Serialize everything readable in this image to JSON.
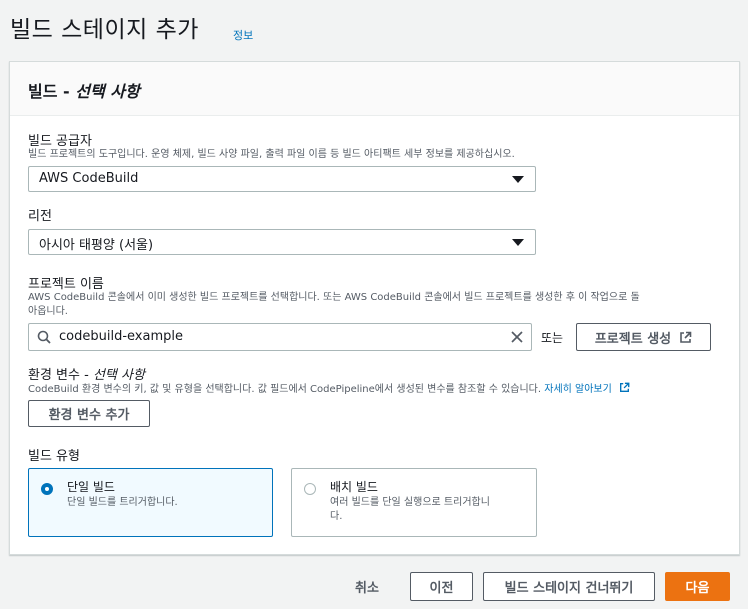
{
  "page": {
    "title": "빌드 스테이지 추가",
    "info_link": "정보"
  },
  "panel": {
    "title_main": "빌드 - ",
    "title_optional": "선택 사항"
  },
  "provider": {
    "label": "빌드 공급자",
    "description": "빌드 프로젝트의 도구입니다. 운영 체제, 빌드 사양 파일, 출력 파일 이름 등 빌드 아티팩트 세부 정보를 제공하십시오.",
    "selected": "AWS CodeBuild"
  },
  "region": {
    "label": "리전",
    "selected": "아시아 태평양 (서울)"
  },
  "project": {
    "label": "프로젝트 이름",
    "description_line1": "AWS CodeBuild 콘솔에서 이미 생성한 빌드 프로젝트를 선택합니다. 또는 AWS CodeBuild 콘솔에서 빌드 프로젝트를 생성한 후 이 작업으로 돌",
    "description_line2": "아옵니다.",
    "search_value": "codebuild-example",
    "or_text": "또는",
    "create_button": "프로젝트 생성"
  },
  "env": {
    "label_main": "환경 변수 - ",
    "label_optional": "선택 사항",
    "description": "CodeBuild 환경 변수의 키, 값 및 유형을 선택합니다. 값 필드에서 CodePipeline에서 생성된 변수를 참조할 수 있습니다. ",
    "learn_more": "자세히 알아보기",
    "add_button": "환경 변수 추가"
  },
  "build_type": {
    "label": "빌드 유형",
    "options": [
      {
        "title": "단일 빌드",
        "description": "단일 빌드를 트리거합니다.",
        "selected": true
      },
      {
        "title": "배치 빌드",
        "description_line1": "여러 빌드를 단일 실행으로 트리거합니",
        "description_line2": "다.",
        "selected": false
      }
    ]
  },
  "footer": {
    "cancel": "취소",
    "previous": "이전",
    "skip": "빌드 스테이지 건너뛰기",
    "next": "다음"
  },
  "colors": {
    "accent": "#0073bb",
    "primary": "#ec7211",
    "background": "#f2f3f3"
  }
}
